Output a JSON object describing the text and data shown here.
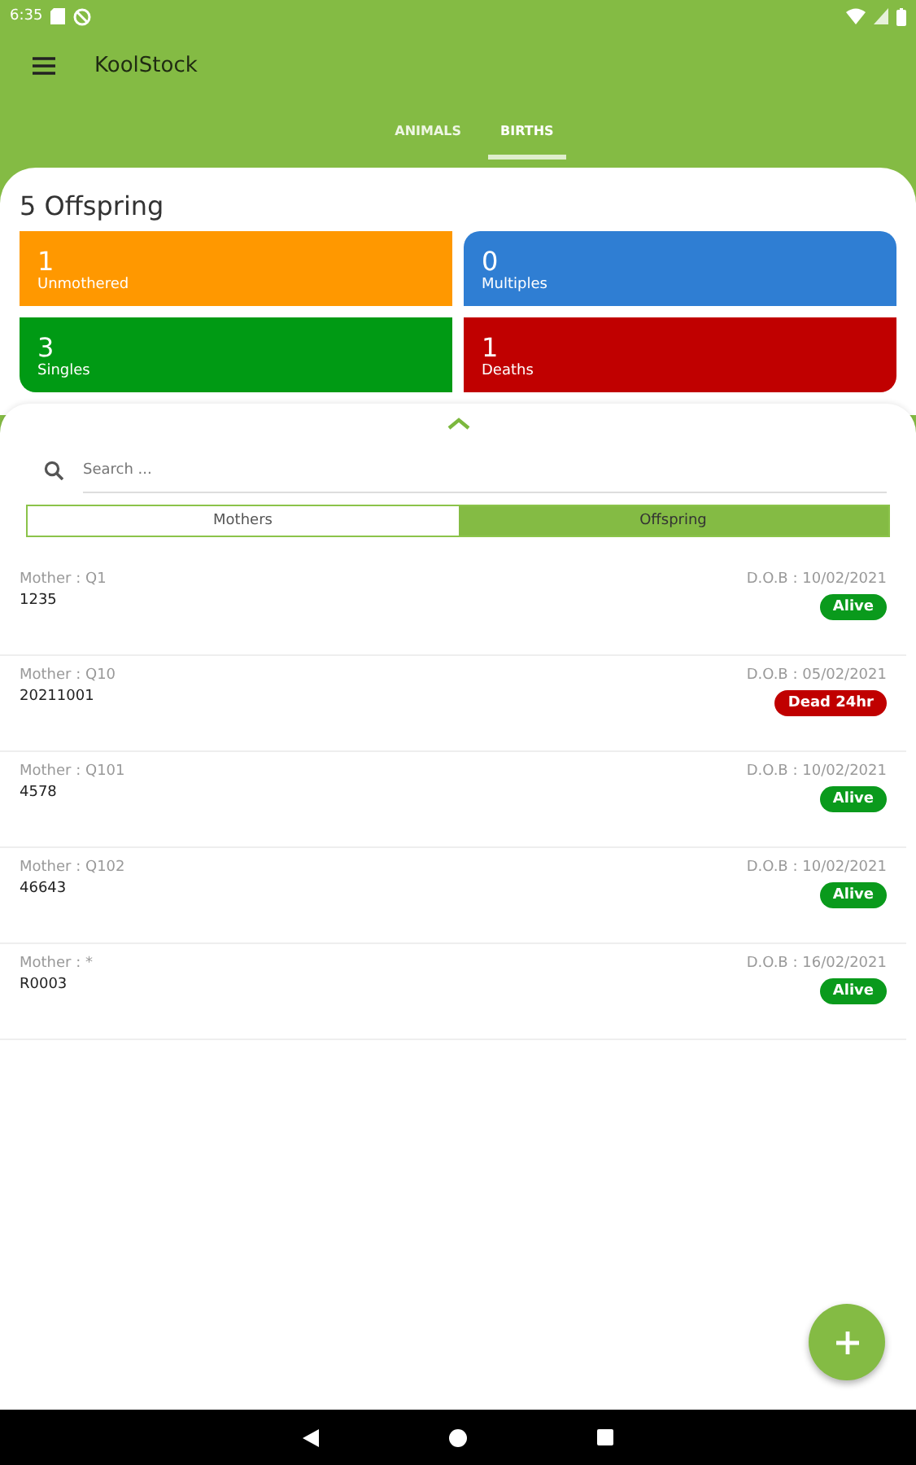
{
  "status_bar": {
    "time": "6:35"
  },
  "app_bar": {
    "title": "KoolStock"
  },
  "tabs": [
    {
      "label": "ANIMALS",
      "selected": false
    },
    {
      "label": "BIRTHS",
      "selected": true
    }
  ],
  "summary": {
    "title": "5 Offspring",
    "stats": [
      {
        "value": "1",
        "label": "Unmothered",
        "color": "#ff9800"
      },
      {
        "value": "0",
        "label": "Multiples",
        "color": "#2f7ed3"
      },
      {
        "value": "3",
        "label": "Singles",
        "color": "#009a14"
      },
      {
        "value": "1",
        "label": "Deaths",
        "color": "#c00000"
      }
    ]
  },
  "search": {
    "placeholder": "Search ..."
  },
  "toggle": [
    {
      "label": "Mothers",
      "selected": false
    },
    {
      "label": "Offspring",
      "selected": true
    }
  ],
  "births": [
    {
      "mother": "Mother : Q1",
      "tag": "1235",
      "dob": "D.O.B : 10/02/2021",
      "status": "Alive",
      "kind": "alive"
    },
    {
      "mother": "Mother : Q10",
      "tag": "20211001",
      "dob": "D.O.B : 05/02/2021",
      "status": "Dead 24hr",
      "kind": "dead"
    },
    {
      "mother": "Mother : Q101",
      "tag": "4578",
      "dob": "D.O.B : 10/02/2021",
      "status": "Alive",
      "kind": "alive"
    },
    {
      "mother": "Mother : Q102",
      "tag": "46643",
      "dob": "D.O.B : 10/02/2021",
      "status": "Alive",
      "kind": "alive"
    },
    {
      "mother": "Mother :  *",
      "tag": "R0003",
      "dob": "D.O.B : 16/02/2021",
      "status": "Alive",
      "kind": "alive"
    }
  ]
}
